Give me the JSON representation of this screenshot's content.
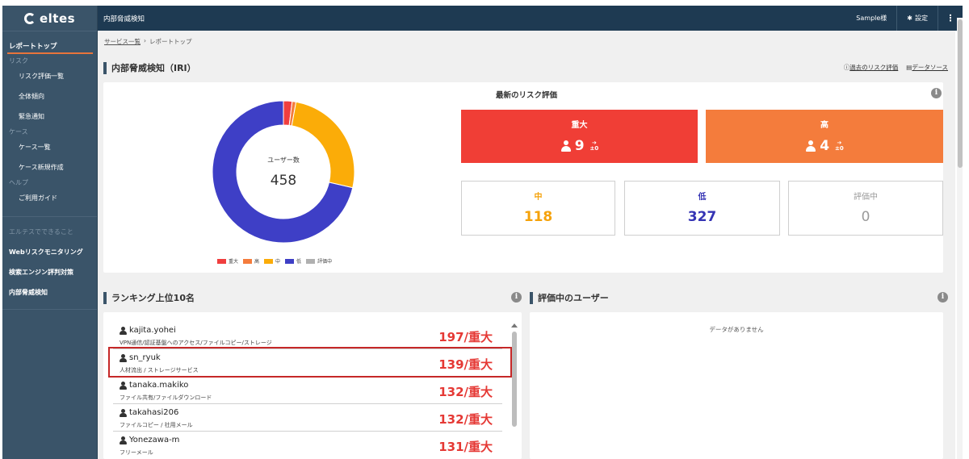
{
  "sidebar": {
    "logo": "eltes",
    "active_item": "レポートトップ",
    "groups": [
      {
        "label": "リスク",
        "items": [
          "リスク評価一覧",
          "全体傾向",
          "緊急通知"
        ]
      },
      {
        "label": "ケース",
        "items": [
          "ケース一覧",
          "ケース新規作成"
        ]
      },
      {
        "label": "ヘルプ",
        "items": [
          "ご利用ガイド"
        ]
      }
    ],
    "muted_item": "エルテスでできること",
    "links": [
      "Webリスクモニタリング",
      "検索エンジン評判対策",
      "内部脅威検知"
    ]
  },
  "topbar": {
    "title": "内部脅威検知",
    "user": "Sample様",
    "settings": "設定",
    "more": "⋮"
  },
  "breadcrumb": {
    "root": "サービス一覧",
    "separator": "›",
    "current": "レポートトップ"
  },
  "page": {
    "title": "内部脅威検知（IRI）",
    "link_history": "過去のリスク評価",
    "link_source": "データソース"
  },
  "overview": {
    "user_label": "ユーザー数",
    "user_count": "458",
    "legend": [
      {
        "label": "重大",
        "color": "#f03e3e"
      },
      {
        "label": "高",
        "color": "#f47c3c"
      },
      {
        "label": "中",
        "color": "#fbac08"
      },
      {
        "label": "低",
        "color": "#3e3fc6"
      },
      {
        "label": "評価中",
        "color": "#b0b0b0"
      }
    ],
    "donut_values": [
      9,
      4,
      118,
      327,
      0
    ],
    "latest_title": "最新のリスク評価",
    "critical": {
      "label": "重大",
      "count": "9",
      "delta": "±0",
      "color": "#f03e36"
    },
    "high": {
      "label": "高",
      "count": "4",
      "delta": "±0",
      "color": "#f47c3c"
    },
    "medium": {
      "label": "中",
      "count": "118",
      "color": "#f5a20a"
    },
    "low": {
      "label": "低",
      "count": "327",
      "color": "#3534b4"
    },
    "pending": {
      "label": "評価中",
      "count": "0",
      "color": "#9a9a9a"
    }
  },
  "ranking": {
    "title": "ランキング上位10名",
    "rows": [
      {
        "name": "kajita.yohei",
        "desc": "VPN通信/認証基盤へのアクセス/ファイルコピー/ストレージ",
        "score": "197/重大"
      },
      {
        "name": "sn_ryuk",
        "desc": "人材流出 / ストレージサービス",
        "score": "139/重大"
      },
      {
        "name": "tanaka.makiko",
        "desc": "ファイル共有/ファイルダウンロード",
        "score": "132/重大"
      },
      {
        "name": "takahasi206",
        "desc": "ファイルコピー / 社用メール",
        "score": "132/重大"
      },
      {
        "name": "Yonezawa-m",
        "desc": "フリーメール",
        "score": "131/重大"
      }
    ]
  },
  "pending_users": {
    "title": "評価中のユーザー",
    "empty": "データがありません"
  }
}
